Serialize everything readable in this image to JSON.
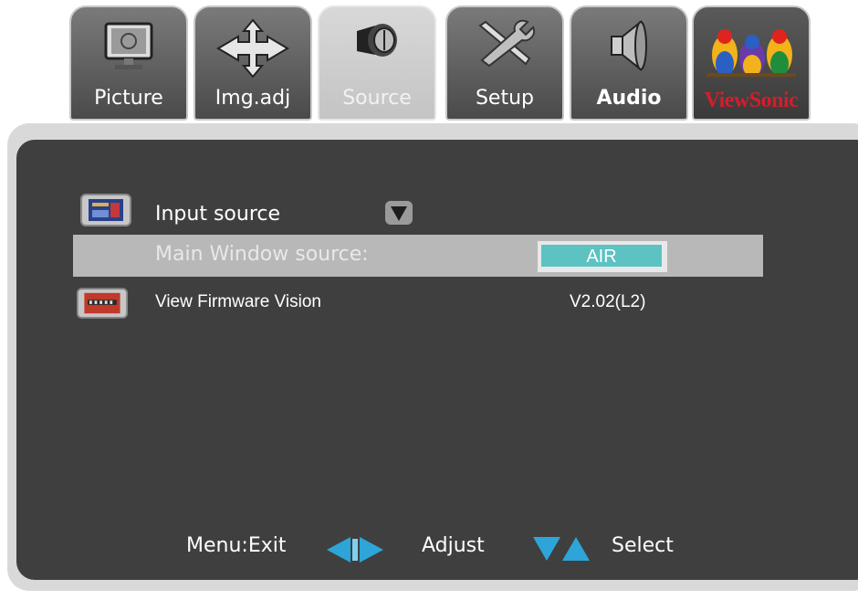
{
  "tabs": [
    {
      "label": "Picture",
      "icon": "monitor-icon"
    },
    {
      "label": "Img.adj",
      "icon": "move-arrows-icon"
    },
    {
      "label": "Source",
      "icon": "plug-icon",
      "active": true
    },
    {
      "label": "Setup",
      "icon": "tools-icon"
    },
    {
      "label": "Audio",
      "icon": "speaker-icon"
    },
    {
      "label": "ViewSonic",
      "icon": "viewsonic-birds-logo"
    }
  ],
  "menu": {
    "input_source": {
      "label": "Input source",
      "icon": "input-source-icon"
    },
    "main_window": {
      "label": "Main Window source:",
      "value": "AIR"
    },
    "firmware": {
      "label": "View Firmware Vision",
      "value": "V2.02(L2)",
      "icon": "firmware-icon"
    }
  },
  "footer": {
    "exit": "Menu:Exit",
    "adjust": "Adjust",
    "select": "Select"
  },
  "colors": {
    "panel": "#3f3f3f",
    "highlight": "#b8b8b8",
    "value_box": "#5cc2c2",
    "arrow_blue": "#2ea5d8"
  }
}
